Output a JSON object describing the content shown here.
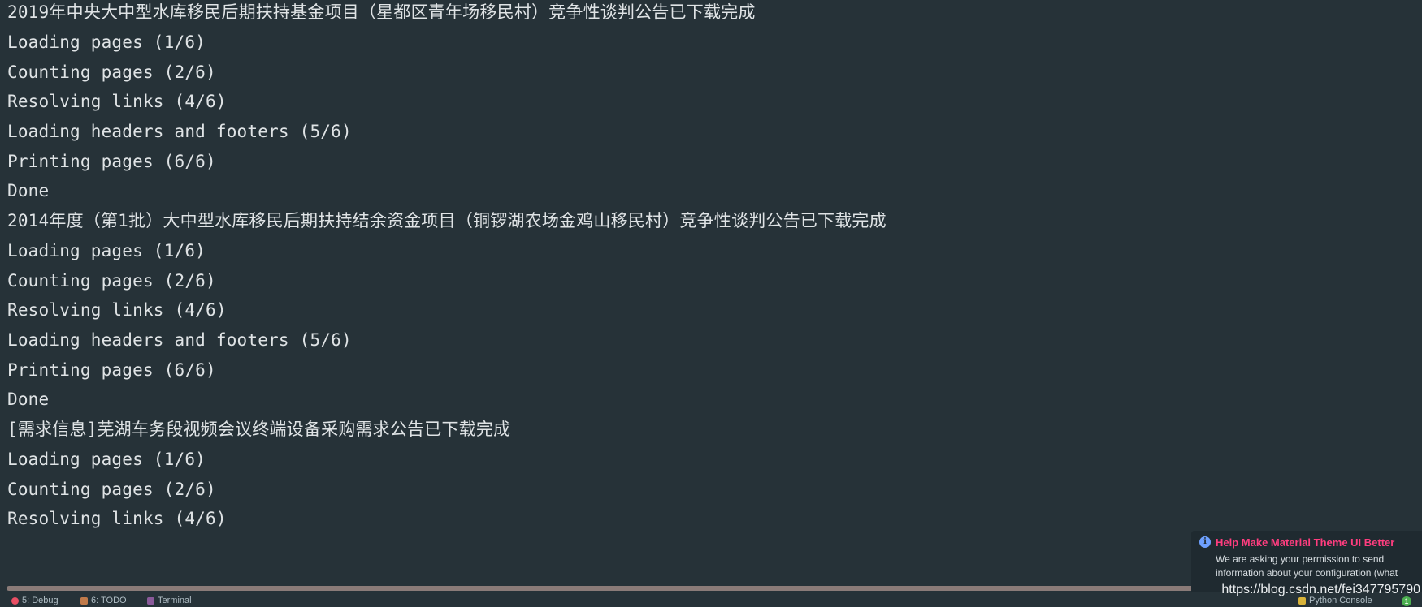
{
  "console": {
    "lines": [
      "2019年中央大中型水库移民后期扶持基金项目（星都区青年场移民村）竞争性谈判公告已下载完成",
      "Loading pages (1/6)",
      "Counting pages (2/6)",
      "Resolving links (4/6)",
      "Loading headers and footers (5/6)",
      "Printing pages (6/6)",
      "Done",
      "2014年度（第1批）大中型水库移民后期扶持结余资金项目（铜锣湖农场金鸡山移民村）竞争性谈判公告已下载完成",
      "Loading pages (1/6)",
      "Counting pages (2/6)",
      "Resolving links (4/6)",
      "Loading headers and footers (5/6)",
      "Printing pages (6/6)",
      "Done",
      "[需求信息]芜湖车务段视频会议终端设备采购需求公告已下载完成",
      "Loading pages (1/6)",
      "Counting pages (2/6)",
      "Resolving links (4/6)"
    ]
  },
  "notification": {
    "icon": "info-icon",
    "title": "Help Make Material Theme UI Better",
    "body": "We are asking your permission to send information about your configuration (what"
  },
  "toolwindows": {
    "debug": "5: Debug",
    "todo": "6: TODO",
    "terminal": "Terminal",
    "python_console": "Python Console",
    "event_count": "1"
  },
  "watermark": "https://blog.csdn.net/fei347795790",
  "colors": {
    "background": "#263238",
    "text": "#dfe3e5",
    "notification_title": "#ff3d7f"
  }
}
